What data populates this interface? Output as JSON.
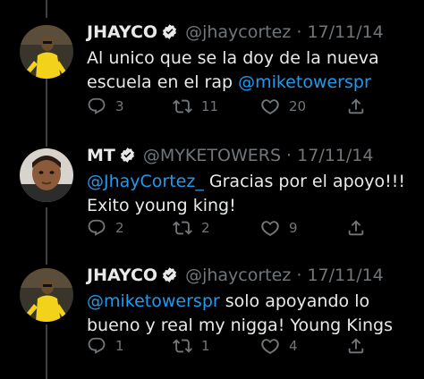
{
  "tweets": [
    {
      "name": "JHAYCO",
      "handle": "@jhaycortez",
      "separator": "·",
      "date": "17/11/14",
      "text_before": "Al unico que se la doy de la nueva escuela en el rap ",
      "mention": "@miketowerspr",
      "text_after": "",
      "replies": "3",
      "retweets": "11",
      "likes": "20",
      "avatar": "yellow-suit-person"
    },
    {
      "name": "MT",
      "handle": "@MYKETOWERS",
      "separator": "·",
      "date": "17/11/14",
      "text_before": "",
      "mention": "@JhayCortez_",
      "text_after": " Gracias por el apoyo!!! Exito young king!",
      "replies": "2",
      "retweets": "2",
      "likes": "9",
      "avatar": "child-photo"
    },
    {
      "name": "JHAYCO",
      "handle": "@jhaycortez",
      "separator": "·",
      "date": "17/11/14",
      "text_before": "",
      "mention": "@miketowerspr",
      "text_after": " solo apoyando lo bueno y real my nigga! Young Kings",
      "replies": "1",
      "retweets": "1",
      "likes": "4",
      "avatar": "yellow-suit-person"
    }
  ],
  "colors": {
    "background": "#000000",
    "mention": "#1d9bf0",
    "muted": "#71767b",
    "text": "#e7e9ea"
  }
}
